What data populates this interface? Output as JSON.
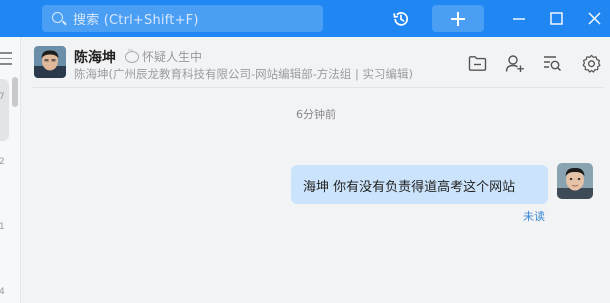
{
  "search": {
    "placeholder": "搜索 (Ctrl+Shift+F)"
  },
  "titlebar": {
    "icons": [
      "search-icon",
      "history-icon",
      "plus-icon",
      "minimize-icon",
      "maximize-icon",
      "close-icon"
    ],
    "accent": "#1f86f2"
  },
  "left_strip": {
    "numbers": [
      "7",
      "2",
      "1",
      "4"
    ]
  },
  "chat": {
    "contact_name": "陈海坤",
    "status_text": "怀疑人生中",
    "contact_org": "陈海坤(广州辰龙教育科技有限公司-网站编辑部-方法组 | 实习编辑)",
    "header_actions": [
      "folder-icon",
      "add-member-icon",
      "search-history-icon",
      "settings-icon"
    ]
  },
  "messages": {
    "time": "6分钟前",
    "items": [
      {
        "text": "海坤  你有没有负责得道高考这个网站",
        "read_status": "未读",
        "bubble_color": "#cce4fb"
      }
    ]
  }
}
